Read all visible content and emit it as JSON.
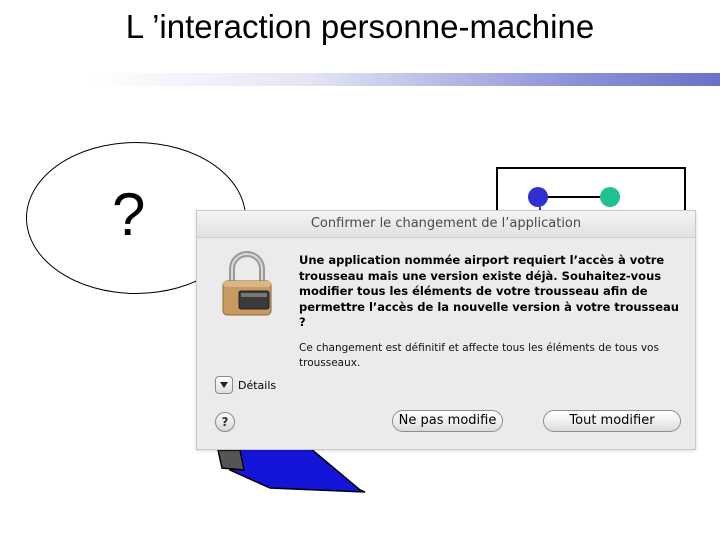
{
  "slide": {
    "title": "L ’interaction personne-machine",
    "thought_text": "?"
  },
  "dialog": {
    "title": "Confirmer le changement de l’application",
    "message": "Une application nommée airport requiert l’accès à votre trousseau mais une version existe déjà. Souhaitez-vous modifier tous les éléments de votre trousseau afin de permettre l’accès de la nouvelle version à votre trousseau ?",
    "info": "Ce changement est définitif et affecte tous les éléments de tous vos trousseaux.",
    "details_label": "Détails",
    "help_label": "?",
    "dont_modify_label": "Ne pas modifie",
    "modify_all_label": "Tout modifier"
  },
  "colors": {
    "title_rule_end": "#6b70c8",
    "diagram_node_blue": "#3030d0",
    "diagram_node_green": "#20c090",
    "figure_blue": "#1515d8",
    "lock_body": "#c89a60"
  },
  "icons": {
    "lock": "lock-icon",
    "disclosure": "triangle-down-icon",
    "help": "question-icon"
  }
}
